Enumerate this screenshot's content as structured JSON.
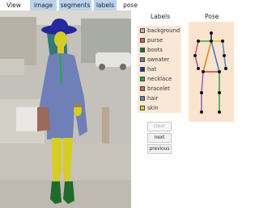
{
  "tabs": [
    {
      "label": "View",
      "active": false
    },
    {
      "label": "image",
      "active": true
    },
    {
      "label": "segments",
      "active": true
    },
    {
      "label": "labels",
      "active": true
    },
    {
      "label": "pose",
      "active": false
    }
  ],
  "labels_panel": {
    "title": "Labels",
    "items": [
      {
        "label": "background",
        "color": "#c2b4a6"
      },
      {
        "label": "purse",
        "color": "#b16b6b"
      },
      {
        "label": "boots",
        "color": "#1f6b2c"
      },
      {
        "label": "sweater",
        "color": "#5b7bb5"
      },
      {
        "label": "hat",
        "color": "#282a9a"
      },
      {
        "label": "necklace",
        "color": "#20a84a"
      },
      {
        "label": "bracelet",
        "color": "#b07a4a"
      },
      {
        "label": "hair",
        "color": "#5a8aa8"
      },
      {
        "label": "skin",
        "color": "#d8d020"
      }
    ]
  },
  "pose_panel": {
    "title": "Pose"
  },
  "buttons": {
    "clear": "clear",
    "next": "next",
    "previous": "previous"
  }
}
